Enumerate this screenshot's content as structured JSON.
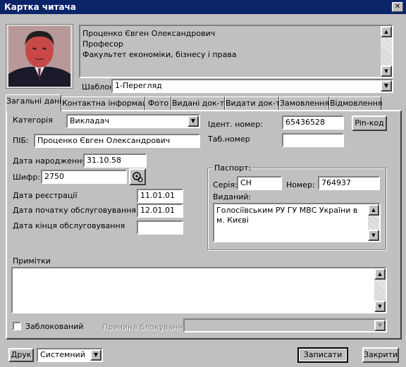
{
  "window": {
    "title": "Картка читача",
    "close_label": "✕"
  },
  "header": {
    "info_lines": [
      "Проценко Євген Олександрович",
      "Професор",
      "Факультет економіки, бізнесу і права"
    ],
    "template_label": "Шаблон",
    "template_value": "1-Перегляд"
  },
  "tabs": [
    {
      "label": "Загальні дані",
      "active": true
    },
    {
      "label": "Контактна інформація"
    },
    {
      "label": "Фото"
    },
    {
      "label": "Видані док-ти"
    },
    {
      "label": "Видати док-ти"
    },
    {
      "label": "Замовлення"
    },
    {
      "label": "Відмовлення"
    }
  ],
  "general": {
    "category_label": "Категорія",
    "category_value": "Викладач",
    "pib_label": "ПІБ:",
    "pib_value": "Проценко Євген Олександрович",
    "birth_label": "Дата народження:",
    "birth_value": "31.10.58",
    "cipher_label": "Шифр:",
    "cipher_value": "2750",
    "reg_label": "Дата реєстрації",
    "reg_value": "11.01.01",
    "service_start_label": "Дата початку обслуговування",
    "service_start_value": "12.01.01",
    "service_end_label": "Дата кінця обслуговування",
    "service_end_value": "",
    "ident_label": "Ідент. номер:",
    "ident_value": "65436528",
    "pin_button": "Pin-код",
    "tab_label": "Таб.номер",
    "tab_value": ""
  },
  "passport": {
    "legend": "Паспорт:",
    "series_label": "Серія:",
    "series_value": "СН",
    "number_label": "Номер:",
    "number_value": "764937",
    "issued_label": "Виданий:",
    "issued_value": "Голосіївським РУ ГУ МВС України в м. Києві"
  },
  "notes": {
    "label": "Примітки",
    "value": ""
  },
  "blocked": {
    "label": "Заблокований",
    "checked": false,
    "reason_label": "Причина блокування",
    "reason_value": ""
  },
  "footer": {
    "print_button": "Друк",
    "printer_value": "Системний",
    "save_button": "Записати",
    "close_button": "Закрити"
  }
}
